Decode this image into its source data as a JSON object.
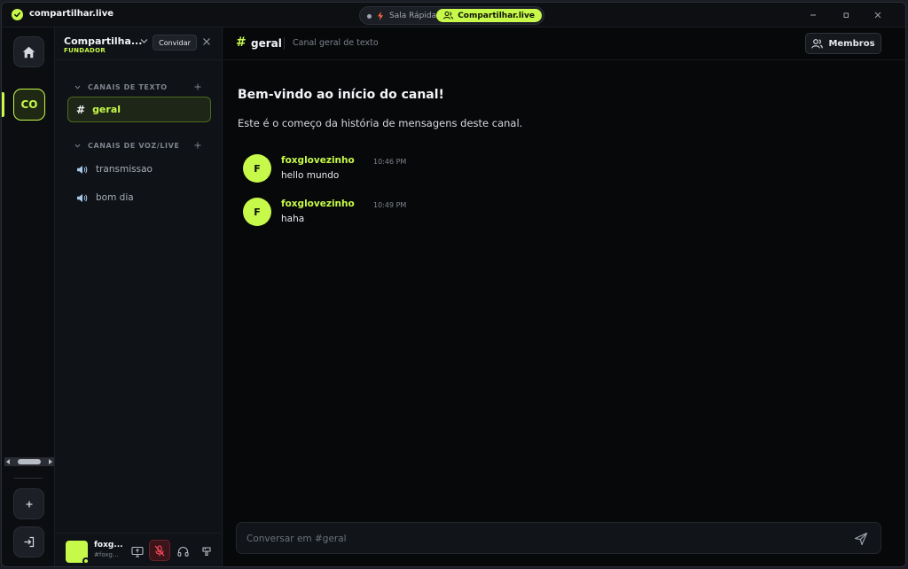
{
  "titlebar": {
    "app_title": "compartilhar.live",
    "mode_quick": "Sala Rápida",
    "mode_active": "Compartilhar.live",
    "accent": "#c6f94a"
  },
  "rail": {
    "server_initials": "CO"
  },
  "sidebar": {
    "server_name": "Compartilha...",
    "server_role": "FUNDADOR",
    "invite_label": "Convidar",
    "text_category": "CANAIS DE TEXTO",
    "voice_category": "CANAIS DE VOZ/LIVE",
    "text_channels": [
      {
        "name": "geral",
        "active": true
      }
    ],
    "voice_channels": [
      {
        "name": "transmissao"
      },
      {
        "name": "bom dia"
      }
    ]
  },
  "user": {
    "name": "foxg...",
    "tag": "#foxg..."
  },
  "channel": {
    "hash": "#",
    "name": "geral",
    "description": "Canal geral de texto",
    "members_label": "Membros"
  },
  "welcome": {
    "title": "Bem-vindo ao início do canal!",
    "subtitle": "Este é o começo da história de mensagens deste canal."
  },
  "messages": [
    {
      "avatar": "F",
      "author": "foxglovezinho",
      "time": "10:46 PM",
      "text": "hello mundo"
    },
    {
      "avatar": "F",
      "author": "foxglovezinho",
      "time": "10:49 PM",
      "text": "haha"
    }
  ],
  "composer": {
    "placeholder": "Conversar em #geral"
  }
}
